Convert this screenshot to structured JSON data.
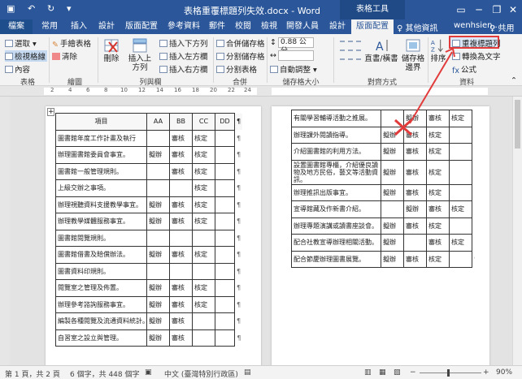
{
  "titlebar": {
    "title": "表格重覆標題列失效.docx - Word",
    "context_tab": "表格工具",
    "minimize": "─",
    "restore": "❐",
    "close": "✕"
  },
  "tabs": [
    {
      "label": "檔案"
    },
    {
      "label": "常用"
    },
    {
      "label": "插入"
    },
    {
      "label": "設計"
    },
    {
      "label": "版面配置"
    },
    {
      "label": "參考資料"
    },
    {
      "label": "郵件"
    },
    {
      "label": "校閱"
    },
    {
      "label": "檢視"
    },
    {
      "label": "開發人員"
    },
    {
      "label": "設計"
    },
    {
      "label": "版面配置"
    }
  ],
  "tell_me": "♀ 其他資訊",
  "user": "wenhsien...",
  "share": "♀ 共用",
  "ribbon": {
    "select": "選取",
    "view_gridlines": "檢視格線",
    "properties": "內容",
    "group_table": "表格",
    "draw_table": "手繪表格",
    "eraser": "清除",
    "group_draw": "繪圖",
    "delete": "刪除",
    "insert_above": "插入上方列",
    "insert_below": "插入下方列",
    "insert_left": "插入左方欄",
    "insert_right": "插入右方欄",
    "group_rows_cols": "列與欄",
    "merge_cells": "合併儲存格",
    "split_cells": "分割儲存格",
    "split_table": "分割表格",
    "group_merge": "合併",
    "height_value": "0.88 公分",
    "width_value": "",
    "autofit": "自動調整",
    "group_cell_size": "儲存格大小",
    "text_direction": "直書/橫書",
    "cell_margins": "儲存格邊界",
    "group_alignment": "對齊方式",
    "sort": "排序",
    "repeat_header_rows": "重複標題列",
    "convert_to_text": "轉換為文字",
    "formula": "公式",
    "group_data": "資料"
  },
  "ruler_numbers": [
    "2",
    "4",
    "6",
    "8",
    "10",
    "12",
    "14",
    "16",
    "18",
    "20",
    "22",
    "24"
  ],
  "table1": {
    "headers": [
      "項目",
      "AA",
      "BB",
      "CC",
      "DD"
    ],
    "rows": [
      [
        "圖書館年度工作計畫及執行",
        "",
        "審核",
        "核定",
        ""
      ],
      [
        "辦理圖書館委員會事宜。",
        "擬辦",
        "審核",
        "核定",
        ""
      ],
      [
        "圖書館一般管理規則。",
        "",
        "審核",
        "核定",
        ""
      ],
      [
        "上級交辦之事項。",
        "",
        "",
        "核定",
        ""
      ],
      [
        "辦理視聽資料支援教學事宜。",
        "擬辦",
        "審核",
        "核定",
        ""
      ],
      [
        "辦理教學媒體服務事宜。",
        "擬辦",
        "審核",
        "核定",
        ""
      ],
      [
        "圖書館閱覽規則。",
        "",
        "",
        "",
        ""
      ],
      [
        "圖書館借書及賠償辦法。",
        "擬辦",
        "審核",
        "核定",
        ""
      ],
      [
        "圖書資料印規則。",
        "",
        "",
        "",
        ""
      ],
      [
        "閱覽室之管理及佈置。",
        "擬辦",
        "審核",
        "核定",
        ""
      ],
      [
        "辦理參考諮詢服務事宜。",
        "擬辦",
        "審核",
        "核定",
        ""
      ],
      [
        "編製各種閱覽及流通資料統計。",
        "擬辦",
        "審核",
        "",
        ""
      ],
      [
        "自習室之設立與管理。",
        "擬辦",
        "審核",
        "",
        ""
      ]
    ]
  },
  "table2": {
    "rows": [
      [
        "有關學習輔導活動之推展。",
        "",
        "擬辦",
        "審核",
        "核定"
      ],
      [
        "辦理課外閱讀指導。",
        "擬辦",
        "審核",
        "核定",
        ""
      ],
      [
        "介紹圖書館的利用方法。",
        "擬辦",
        "審核",
        "核定",
        ""
      ],
      [
        "設置圖書館專櫃，介紹優良讀物及地方民俗，藝文等活動資訊。",
        "擬辦",
        "審核",
        "核定",
        ""
      ],
      [
        "辦理推訊出版事宜。",
        "擬辦",
        "審核",
        "核定",
        ""
      ],
      [
        "宣導館藏及作新書介紹。",
        "",
        "擬辦",
        "審核",
        "核定"
      ],
      [
        "辦理專題演講或讀書座談會。",
        "擬辦",
        "審核",
        "核定",
        ""
      ],
      [
        "配合社教宣導辦理相關活動。",
        "擬辦",
        "",
        "審核",
        "核定"
      ],
      [
        "配合節慶辦理圖書展覽。",
        "擬辦",
        "審核",
        "核定",
        ""
      ]
    ]
  },
  "statusbar": {
    "page": "第 1 頁，共 2 頁",
    "words": "6 個字，共 448 個字",
    "language": "中文 (臺灣特別行政區)",
    "zoom": "90%"
  },
  "colors": {
    "brand": "#2b579a",
    "highlight": "#e23b3b"
  }
}
